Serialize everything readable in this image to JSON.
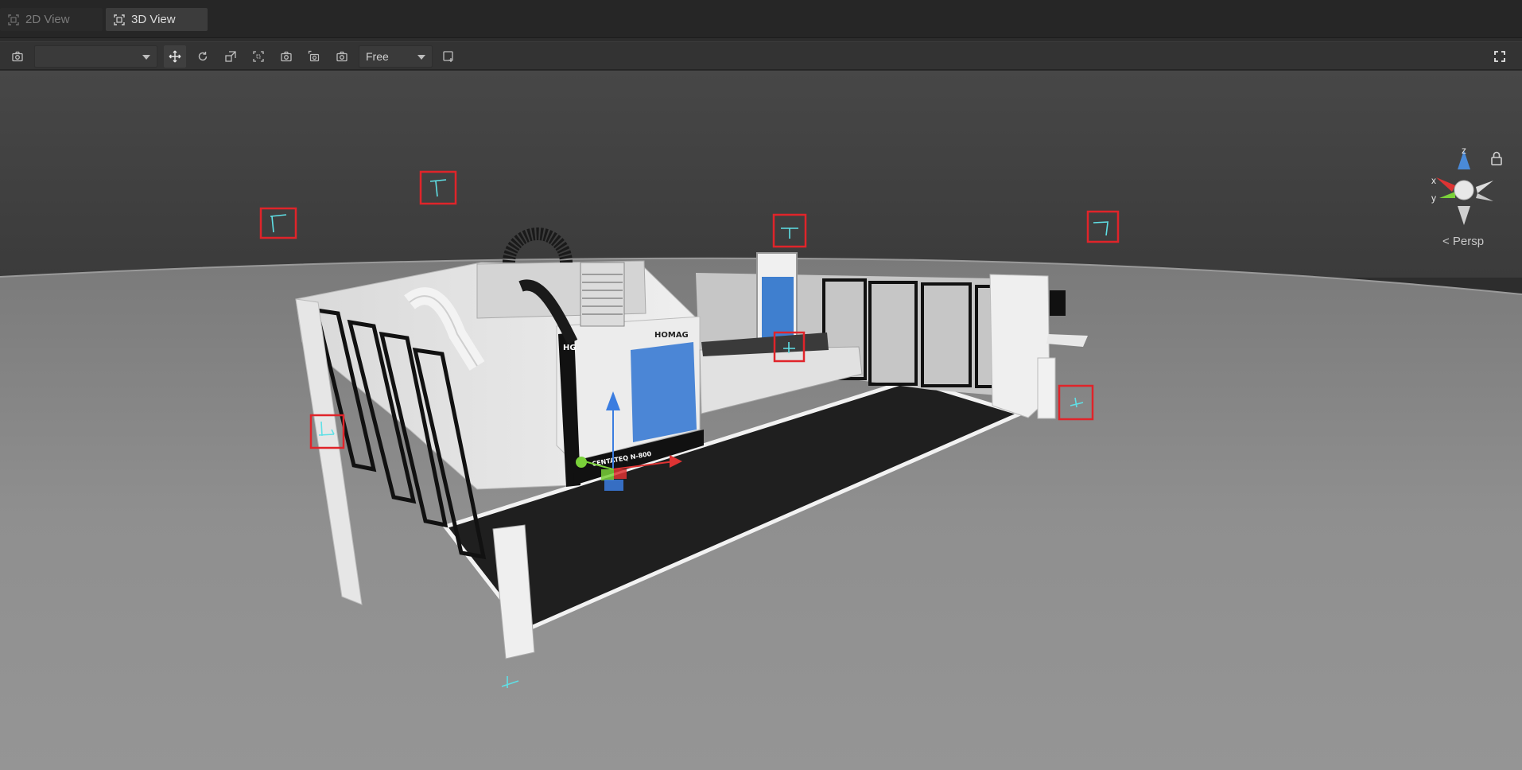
{
  "tabs": [
    {
      "label": "2D View",
      "active": false
    },
    {
      "label": "3D View",
      "active": true
    }
  ],
  "toolbar": {
    "camera_select_value": "",
    "mode_select_value": "Free"
  },
  "viewport": {
    "persp_label": "< Persp",
    "axis_labels": {
      "x": "x",
      "y": "y",
      "z": "z"
    },
    "machine_brand": "HOMAG",
    "machine_logo": "HG",
    "machine_model": "CENTATEQ N-800"
  },
  "colors": {
    "selection_box": "#e0242a",
    "marker": "#5fe0e6",
    "accent_blue": "#4a8ad8",
    "ground": "#8c8c8c"
  }
}
